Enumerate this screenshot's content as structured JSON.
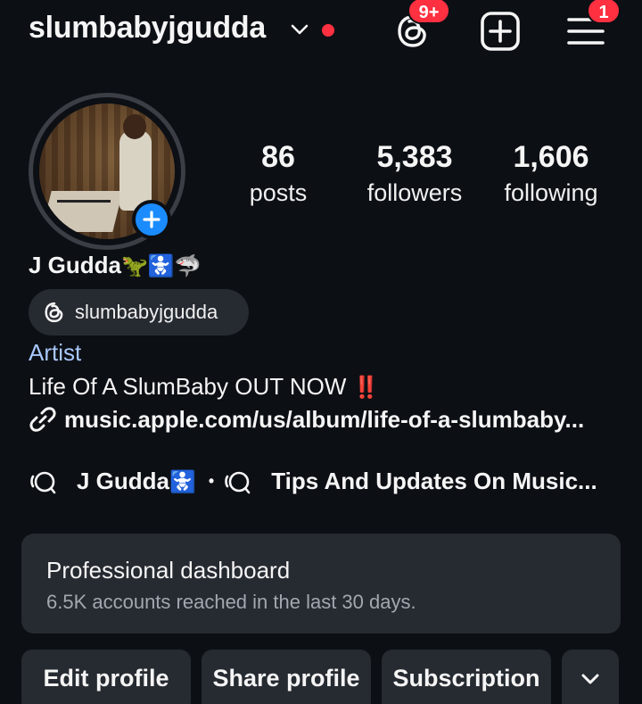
{
  "header": {
    "username": "slumbabyjgudda",
    "threads_badge": "9+",
    "menu_badge": "1"
  },
  "profile": {
    "stats": {
      "posts_count": "86",
      "posts_label": "posts",
      "followers_count": "5,383",
      "followers_label": "followers",
      "following_count": "1,606",
      "following_label": "following"
    },
    "display_name": "J Gudda",
    "display_name_emojis": "🦖🚼🦈",
    "threads_handle": "slumbabyjgudda",
    "category": "Artist",
    "bio": "Life Of A SlumBaby OUT NOW",
    "bio_emoji": "‼️",
    "link": "music.apple.com/us/album/life-of-a-slumbaby..."
  },
  "channels": {
    "first_name": "J Gudda",
    "first_emoji": "🚼",
    "separator": "•",
    "second_name": "Tips And Updates On Music..."
  },
  "dashboard": {
    "title": "Professional dashboard",
    "subtitle": "6.5K accounts reached in the last 30 days."
  },
  "actions": {
    "edit_label": "Edit profile",
    "share_label": "Share profile",
    "subscription_label": "Subscription"
  },
  "colors": {
    "background": "#0c0f14",
    "surface": "#262a31",
    "accent_blue": "#1a8cff",
    "notification_red": "#ff3040",
    "category_blue": "#a8c7fa"
  },
  "icons": [
    "chevron-down-icon",
    "threads-icon",
    "add-post-icon",
    "menu-icon",
    "plus-icon",
    "link-icon",
    "channel-icon"
  ]
}
